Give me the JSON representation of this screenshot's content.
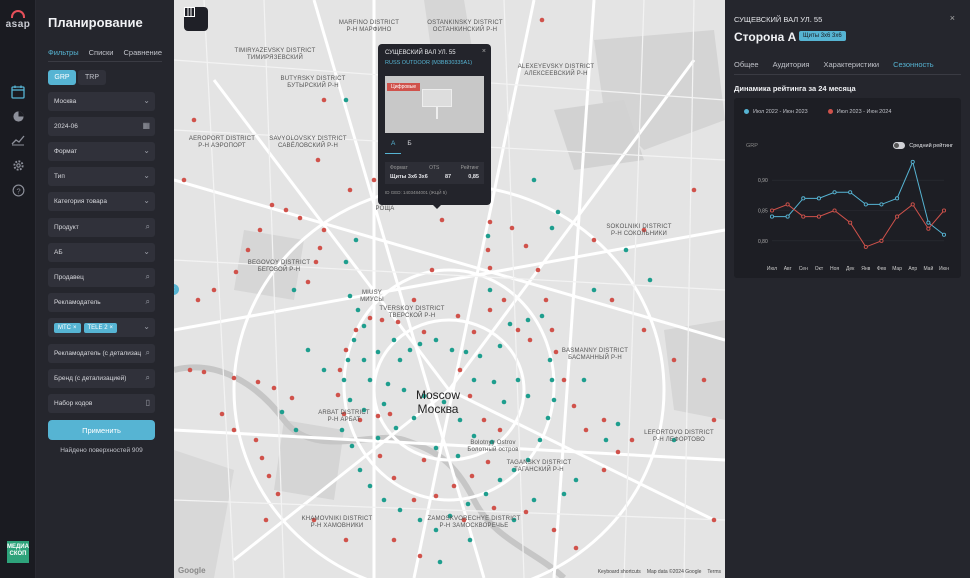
{
  "app": {
    "logo_text": "asap"
  },
  "rail": {
    "items": [
      {
        "name": "calendar-icon",
        "icon": "▦",
        "active": true
      },
      {
        "name": "pie-chart-icon",
        "icon": "◔",
        "active": false
      },
      {
        "name": "line-chart-icon",
        "icon": "∿",
        "active": false
      },
      {
        "name": "gear-icon",
        "icon": "⚙",
        "active": false
      },
      {
        "name": "help-icon",
        "icon": "?",
        "active": false
      }
    ],
    "bottom_badge": "МЕДИА СКОП"
  },
  "filters": {
    "title": "Планирование",
    "tabs": [
      "Фильтры",
      "Списки",
      "Сравнение"
    ],
    "metric_toggle": [
      "GRP",
      "TRP"
    ],
    "fields": {
      "city": "Москва",
      "date": "2024-06",
      "format": "Формат",
      "type": "Тип",
      "category": "Категория товара",
      "product": "Продукт",
      "ab": "АБ",
      "seller": "Продавец",
      "advertiser": "Рекламодатель",
      "advertiser_detail": "Рекламодатель (с детализац",
      "brand_detail": "Бренд (с детализацией)",
      "codes": "Набор кодов"
    },
    "advertiser_chips": [
      "МТС",
      "TELE 2"
    ],
    "apply_label": "Применить",
    "found_text": "Найдено поверхностей 909"
  },
  "map": {
    "city_label_en": "Moscow",
    "city_label_ru": "Москва",
    "districts": [
      {
        "text": "TIMIRYAZEVSKY DISTRICT\nТИМИРЯЗЕВСКИЙ"
      },
      {
        "text": "MARFINO DISTRICT\nР-Н МАРФИНО"
      },
      {
        "text": "OSTANKINSKY DISTRICT\nОСТАНКИНСКИЙ Р-Н"
      },
      {
        "text": "BUTYRSKY DISTRICT\nБУТЫРСКИЙ Р-Н"
      },
      {
        "text": "ALEXEYEVSKY DISTRICT\nАЛЕКСЕЕВСКИЙ Р-Н"
      },
      {
        "text": "AEROPORT DISTRICT\nР-Н АЭРОПОРТ"
      },
      {
        "text": "SAVYOLOVSKY DISTRICT\nСАВЁЛОВСКИЙ Р-Н"
      },
      {
        "text": "SOKOLNIKI DISTRICT\nР-Н СОКОЛЬНИКИ"
      },
      {
        "text": "BEGOVOY DISTRICT\nБЕГОВОЙ Р-Н"
      },
      {
        "text": "MIUSY\nМИУСЫ"
      },
      {
        "text": "TVERSKOY DISTRICT\nТВЕРСКОЙ Р-Н"
      },
      {
        "text": "BASMANNY DISTRICT\nБАСМАННЫЙ Р-Н"
      },
      {
        "text": "ARBAT DISTRICT\nР-Н АРБАТ"
      },
      {
        "text": "LEFORTOVO DISTRICT\nР-Н ЛЕФОРТОВО"
      },
      {
        "text": "Bolotnyy Ostrov\nБолотный остров"
      },
      {
        "text": "TAGANSKY DISTRICT\nТАГАНСКИЙ Р-Н"
      },
      {
        "text": "KHAMOVNIKI DISTRICT\nР-Н ХАМОВНИКИ"
      },
      {
        "text": "ZAMOSKVORECHYE DISTRICT\nР-Н ЗАМОСКВОРЕЧЬЕ"
      },
      {
        "text": "РОЩА"
      }
    ],
    "attribution": [
      "Keyboard shortcuts",
      "Map data ©2024 Google",
      "Terms"
    ],
    "google_logo": "Google"
  },
  "popup": {
    "title": "СУЩЕВСКИЙ ВАЛ УЛ. 55",
    "operator": "RUSS OUTDOOR (M3BB30335A1)",
    "photo_tag": "Цифровые",
    "tabs": [
      "А",
      "Б"
    ],
    "table_headers": [
      "Формат",
      "OTS",
      "Рейтинг"
    ],
    "table_values": [
      "Щиты 3х6 3х6",
      "87",
      "0,85"
    ],
    "gid": "ID GED: 1403484001 (ЖЦЙ 5)"
  },
  "detail": {
    "address": "СУЩЕВСКИЙ ВАЛ УЛ. 55",
    "side": "Сторона А",
    "format_badge": "Щиты 3х6 3х6",
    "tabs": [
      "Общее",
      "Аудитория",
      "Характеристики",
      "Сезонность"
    ],
    "active_tab": "Сезонность",
    "section_title": "Динамика рейтинга за 24 месяца",
    "avg_toggle_label": "Средний рейтинг"
  },
  "colors": {
    "accent": "#56b4d3",
    "red": "#d0524b",
    "teal": "#1e9e8e",
    "panel": "#25262d"
  },
  "chart_data": {
    "type": "line",
    "ylabel": "GRP",
    "categories": [
      "Июл",
      "Авг",
      "Сен",
      "Окт",
      "Ноя",
      "Дек",
      "Янв",
      "Фев",
      "Мар",
      "Апр",
      "Май",
      "Июн"
    ],
    "y_ticks": [
      "0,90",
      "0,85",
      "0,80"
    ],
    "ylim": [
      0.78,
      0.92
    ],
    "legend": "top",
    "series": [
      {
        "name": "Июл 2022 - Июн 2023",
        "color": "#56b4d3",
        "values": [
          0.84,
          0.84,
          0.87,
          0.87,
          0.88,
          0.88,
          0.86,
          0.86,
          0.87,
          0.93,
          0.83,
          0.81
        ]
      },
      {
        "name": "Июл 2023 - Июн 2024",
        "color": "#d0524b",
        "values": [
          0.85,
          0.86,
          0.84,
          0.84,
          0.85,
          0.83,
          0.79,
          0.8,
          0.84,
          0.86,
          0.82,
          0.85
        ]
      }
    ]
  }
}
